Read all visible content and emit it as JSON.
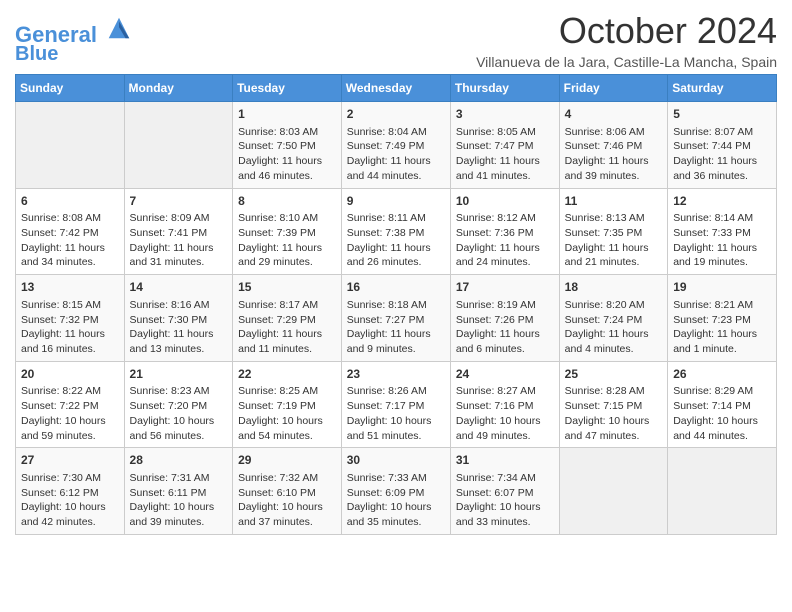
{
  "header": {
    "logo_line1": "General",
    "logo_line2": "Blue",
    "month_title": "October 2024",
    "subtitle": "Villanueva de la Jara, Castille-La Mancha, Spain"
  },
  "weekdays": [
    "Sunday",
    "Monday",
    "Tuesday",
    "Wednesday",
    "Thursday",
    "Friday",
    "Saturday"
  ],
  "weeks": [
    [
      {
        "day": "",
        "data": ""
      },
      {
        "day": "",
        "data": ""
      },
      {
        "day": "1",
        "data": "Sunrise: 8:03 AM\nSunset: 7:50 PM\nDaylight: 11 hours and 46 minutes."
      },
      {
        "day": "2",
        "data": "Sunrise: 8:04 AM\nSunset: 7:49 PM\nDaylight: 11 hours and 44 minutes."
      },
      {
        "day": "3",
        "data": "Sunrise: 8:05 AM\nSunset: 7:47 PM\nDaylight: 11 hours and 41 minutes."
      },
      {
        "day": "4",
        "data": "Sunrise: 8:06 AM\nSunset: 7:46 PM\nDaylight: 11 hours and 39 minutes."
      },
      {
        "day": "5",
        "data": "Sunrise: 8:07 AM\nSunset: 7:44 PM\nDaylight: 11 hours and 36 minutes."
      }
    ],
    [
      {
        "day": "6",
        "data": "Sunrise: 8:08 AM\nSunset: 7:42 PM\nDaylight: 11 hours and 34 minutes."
      },
      {
        "day": "7",
        "data": "Sunrise: 8:09 AM\nSunset: 7:41 PM\nDaylight: 11 hours and 31 minutes."
      },
      {
        "day": "8",
        "data": "Sunrise: 8:10 AM\nSunset: 7:39 PM\nDaylight: 11 hours and 29 minutes."
      },
      {
        "day": "9",
        "data": "Sunrise: 8:11 AM\nSunset: 7:38 PM\nDaylight: 11 hours and 26 minutes."
      },
      {
        "day": "10",
        "data": "Sunrise: 8:12 AM\nSunset: 7:36 PM\nDaylight: 11 hours and 24 minutes."
      },
      {
        "day": "11",
        "data": "Sunrise: 8:13 AM\nSunset: 7:35 PM\nDaylight: 11 hours and 21 minutes."
      },
      {
        "day": "12",
        "data": "Sunrise: 8:14 AM\nSunset: 7:33 PM\nDaylight: 11 hours and 19 minutes."
      }
    ],
    [
      {
        "day": "13",
        "data": "Sunrise: 8:15 AM\nSunset: 7:32 PM\nDaylight: 11 hours and 16 minutes."
      },
      {
        "day": "14",
        "data": "Sunrise: 8:16 AM\nSunset: 7:30 PM\nDaylight: 11 hours and 13 minutes."
      },
      {
        "day": "15",
        "data": "Sunrise: 8:17 AM\nSunset: 7:29 PM\nDaylight: 11 hours and 11 minutes."
      },
      {
        "day": "16",
        "data": "Sunrise: 8:18 AM\nSunset: 7:27 PM\nDaylight: 11 hours and 9 minutes."
      },
      {
        "day": "17",
        "data": "Sunrise: 8:19 AM\nSunset: 7:26 PM\nDaylight: 11 hours and 6 minutes."
      },
      {
        "day": "18",
        "data": "Sunrise: 8:20 AM\nSunset: 7:24 PM\nDaylight: 11 hours and 4 minutes."
      },
      {
        "day": "19",
        "data": "Sunrise: 8:21 AM\nSunset: 7:23 PM\nDaylight: 11 hours and 1 minute."
      }
    ],
    [
      {
        "day": "20",
        "data": "Sunrise: 8:22 AM\nSunset: 7:22 PM\nDaylight: 10 hours and 59 minutes."
      },
      {
        "day": "21",
        "data": "Sunrise: 8:23 AM\nSunset: 7:20 PM\nDaylight: 10 hours and 56 minutes."
      },
      {
        "day": "22",
        "data": "Sunrise: 8:25 AM\nSunset: 7:19 PM\nDaylight: 10 hours and 54 minutes."
      },
      {
        "day": "23",
        "data": "Sunrise: 8:26 AM\nSunset: 7:17 PM\nDaylight: 10 hours and 51 minutes."
      },
      {
        "day": "24",
        "data": "Sunrise: 8:27 AM\nSunset: 7:16 PM\nDaylight: 10 hours and 49 minutes."
      },
      {
        "day": "25",
        "data": "Sunrise: 8:28 AM\nSunset: 7:15 PM\nDaylight: 10 hours and 47 minutes."
      },
      {
        "day": "26",
        "data": "Sunrise: 8:29 AM\nSunset: 7:14 PM\nDaylight: 10 hours and 44 minutes."
      }
    ],
    [
      {
        "day": "27",
        "data": "Sunrise: 7:30 AM\nSunset: 6:12 PM\nDaylight: 10 hours and 42 minutes."
      },
      {
        "day": "28",
        "data": "Sunrise: 7:31 AM\nSunset: 6:11 PM\nDaylight: 10 hours and 39 minutes."
      },
      {
        "day": "29",
        "data": "Sunrise: 7:32 AM\nSunset: 6:10 PM\nDaylight: 10 hours and 37 minutes."
      },
      {
        "day": "30",
        "data": "Sunrise: 7:33 AM\nSunset: 6:09 PM\nDaylight: 10 hours and 35 minutes."
      },
      {
        "day": "31",
        "data": "Sunrise: 7:34 AM\nSunset: 6:07 PM\nDaylight: 10 hours and 33 minutes."
      },
      {
        "day": "",
        "data": ""
      },
      {
        "day": "",
        "data": ""
      }
    ]
  ]
}
